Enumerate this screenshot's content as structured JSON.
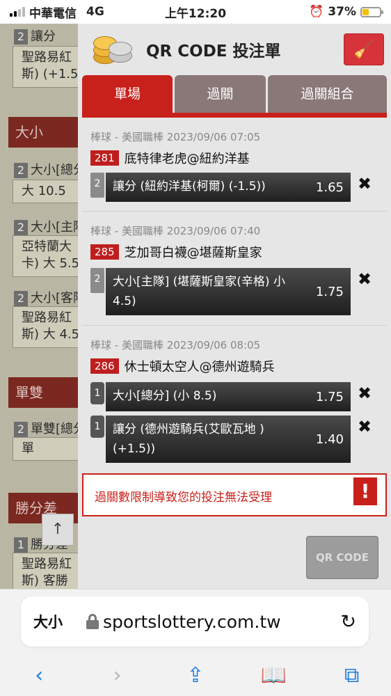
{
  "status": {
    "carrier": "中華電信",
    "network": "4G",
    "time": "上午12:20",
    "alarm_icon": "⏰",
    "battery": "37%",
    "battery_level": 0.37
  },
  "background": {
    "rows": [
      {
        "num": "2",
        "text": "讓分"
      },
      {
        "num": "2",
        "text": "大小[總分"
      },
      {
        "num": "2",
        "text": "大小[主隊"
      },
      {
        "num": "2",
        "text": "大小[客隊"
      },
      {
        "num": "2",
        "text": "單雙[總分"
      },
      {
        "num": "1",
        "text": "勝分差"
      }
    ],
    "boxes": [
      {
        "text": "聖路易紅\n斯) (+1.5"
      },
      {
        "text": "大 10.5"
      },
      {
        "text": "亞特蘭大\n卡) 大 5.5"
      },
      {
        "text": "聖路易紅\n斯) 大 4.5"
      },
      {
        "text": "單"
      },
      {
        "text": "聖路易紅\n斯) 客勝"
      }
    ],
    "heads": [
      "大小",
      "單雙",
      "勝分差"
    ],
    "scroll_up_label": "↑"
  },
  "panel": {
    "title": "QR CODE 投注單",
    "clear_icon": "🧹",
    "tabs": [
      "單場",
      "過關",
      "過關組合"
    ],
    "groups": [
      {
        "head": "棒球 - 美國職棒 2023/09/06 07:05",
        "code": "281",
        "match": "底特律老虎@紐約洋基",
        "bets": [
          {
            "q": "2",
            "text": "讓分 (紐約洋基(柯爾) (-1.5))",
            "odds": "1.65"
          }
        ]
      },
      {
        "head": "棒球 - 美國職棒 2023/09/06 07:40",
        "code": "285",
        "match": "芝加哥白襪@堪薩斯皇家",
        "bets": [
          {
            "q": "2",
            "text": "大小[主隊] (堪薩斯皇家(辛格) 小 4.5)",
            "odds": "1.75"
          }
        ]
      },
      {
        "head": "棒球 - 美國職棒 2023/09/06 08:05",
        "code": "286",
        "match": "休士頓太空人@德州遊騎兵",
        "bets": [
          {
            "q": "1",
            "text": "大小[總分] (小 8.5)",
            "odds": "1.75"
          },
          {
            "q": "1",
            "text": "讓分 (德州遊騎兵(艾歐瓦地 ) (+1.5))",
            "odds": "1.40"
          }
        ]
      }
    ],
    "remove_icon": "✖",
    "warning": "過關數限制導致您的投注無法受理",
    "warning_icon": "!",
    "qr_button": "QR CODE"
  },
  "browser": {
    "aa_label": "大小",
    "url": "sportslottery.com.tw",
    "reload_icon": "↻",
    "toolbar": [
      "‹",
      "›",
      "⇪",
      "📖",
      "⧉"
    ]
  },
  "colors": {
    "accent_red": "#c8211b",
    "tab_inactive": "#8a7878",
    "ios_blue": "#1a7ae0"
  }
}
